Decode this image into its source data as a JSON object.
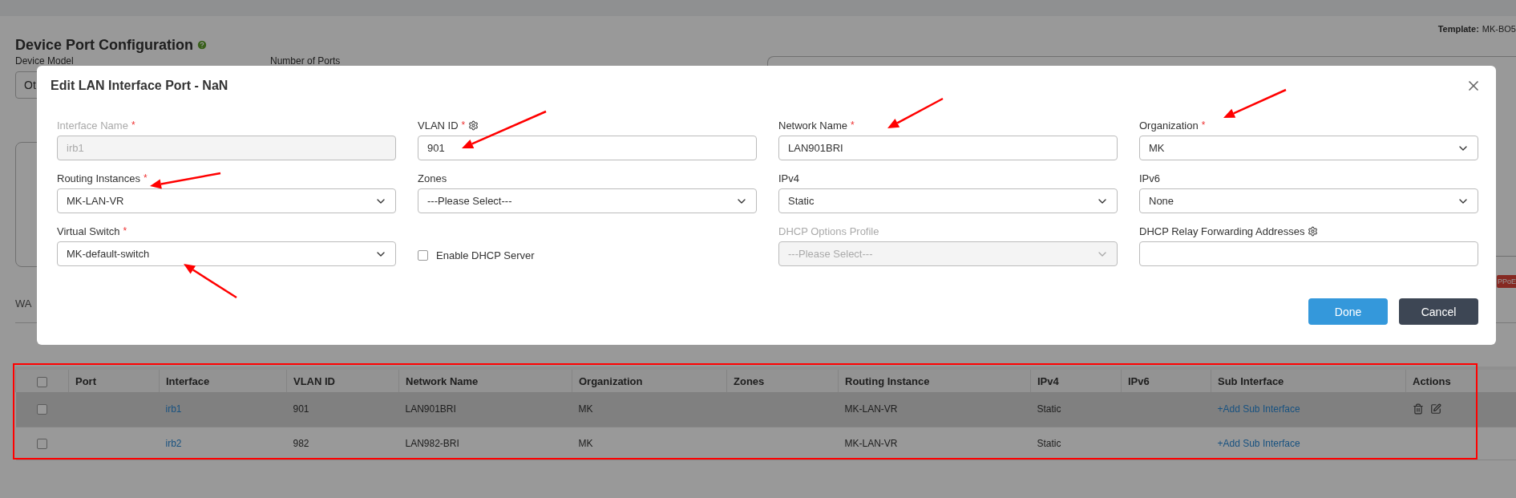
{
  "page": {
    "title": "Device Port Configuration",
    "template_label": "Template:",
    "template_value": "MK-BO5",
    "fields": [
      {
        "label": "Device Model",
        "value": "Ot"
      },
      {
        "label": "Number of Ports"
      }
    ],
    "tab": "WA",
    "badge": "PPoE"
  },
  "table": {
    "header_checkbox": {
      "checked": false
    },
    "columns": [
      "Port",
      "Interface",
      "VLAN ID",
      "Network Name",
      "Organization",
      "Zones",
      "Routing Instance",
      "IPv4",
      "IPv6",
      "Sub Interface",
      "Actions"
    ],
    "rows": [
      {
        "selected": true,
        "checked": false,
        "interface": "irb1",
        "vlan_id": "901",
        "network_name": "LAN901BRI",
        "organization": "MK",
        "routing_instance": "MK-LAN-VR",
        "ipv4": "Static",
        "sub_interface": "+Add Sub Interface"
      },
      {
        "selected": false,
        "checked": false,
        "interface": "irb2",
        "vlan_id": "982",
        "network_name": "LAN982-BRI",
        "organization": "MK",
        "routing_instance": "MK-LAN-VR",
        "ipv4": "Static",
        "sub_interface": "+Add Sub Interface"
      }
    ]
  },
  "modal": {
    "title": "Edit LAN Interface Port - NaN",
    "fields": [
      {
        "kind": "text",
        "label": "Interface Name",
        "required_mark": "*",
        "value": "irb1",
        "disabled": true
      },
      {
        "kind": "text",
        "label": "VLAN ID",
        "required_mark": "*",
        "value": "901",
        "disabled": false,
        "settings_icon": true
      },
      {
        "kind": "text",
        "label": "Network Name",
        "required_mark": "*",
        "value": "LAN901BRI",
        "disabled": false
      },
      {
        "kind": "select",
        "label": "Organization",
        "required_mark": "*",
        "value": "MK",
        "disabled": false
      },
      {
        "kind": "select",
        "label": "Routing Instances",
        "required_mark": "*",
        "value": "MK-LAN-VR",
        "disabled": false
      },
      {
        "kind": "select",
        "label": "Zones",
        "placeholder": "---Please Select---",
        "disabled": false
      },
      {
        "kind": "select",
        "label": "IPv4",
        "value": "Static",
        "disabled": false
      },
      {
        "kind": "select",
        "label": "IPv6",
        "value": "None",
        "disabled": false
      },
      {
        "kind": "select",
        "label": "Virtual Switch",
        "required_mark": "*",
        "value": "MK-default-switch",
        "disabled": false
      },
      {
        "kind": "checkbox",
        "label": "Enable DHCP Server",
        "checked": false
      },
      {
        "kind": "select",
        "label": "DHCP Options Profile",
        "placeholder": "---Please Select---",
        "disabled": true
      },
      {
        "kind": "text",
        "label": "DHCP Relay Forwarding Addresses",
        "disabled": false,
        "settings_icon": true
      }
    ],
    "buttons": [
      {
        "label": "Done",
        "kind": "primary"
      },
      {
        "label": "Cancel",
        "kind": "secondary"
      }
    ]
  }
}
